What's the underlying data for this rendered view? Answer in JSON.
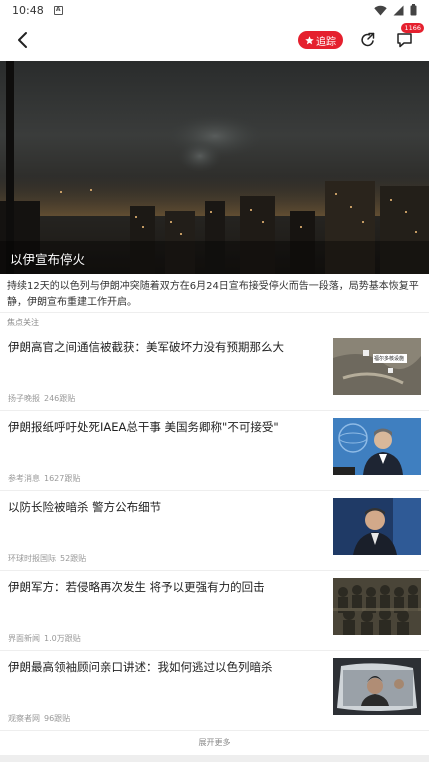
{
  "status_bar": {
    "time": "10:48",
    "notif_glyph": "A"
  },
  "nav": {
    "follow_label": "追踪",
    "badge": "1166"
  },
  "hero": {
    "caption": "以伊宣布停火"
  },
  "summary": "持续12天的以色列与伊朗冲突随着双方在6月24日宣布接受停火而告一段落，局势基本恢复平静，伊朗宣布重建工作开启。",
  "section_label": "焦点关注",
  "news": [
    {
      "title": "伊朗高官之间通信被截获：美军破坏力没有预期那么大",
      "source": "扬子晚报",
      "count": "246跟贴",
      "thumb_overlay": "福尔多核设施"
    },
    {
      "title": "伊朗报纸呼吁处死IAEA总干事 美国务卿称\"不可接受\"",
      "source": "参考消息",
      "count": "1627跟贴"
    },
    {
      "title": "以防长险被暗杀 警方公布细节",
      "source": "环球时报国际",
      "count": "52跟贴"
    },
    {
      "title": "伊朗军方：若侵略再次发生 将予以更强有力的回击",
      "source": "界面新闻",
      "count": "1.0万跟贴"
    },
    {
      "title": "伊朗最高领袖顾问亲口讲述：我如何逃过以色列暗杀",
      "source": "观察者网",
      "count": "96跟贴"
    }
  ],
  "more_label": "展开更多",
  "colors": {
    "accent": "#e5202e"
  }
}
